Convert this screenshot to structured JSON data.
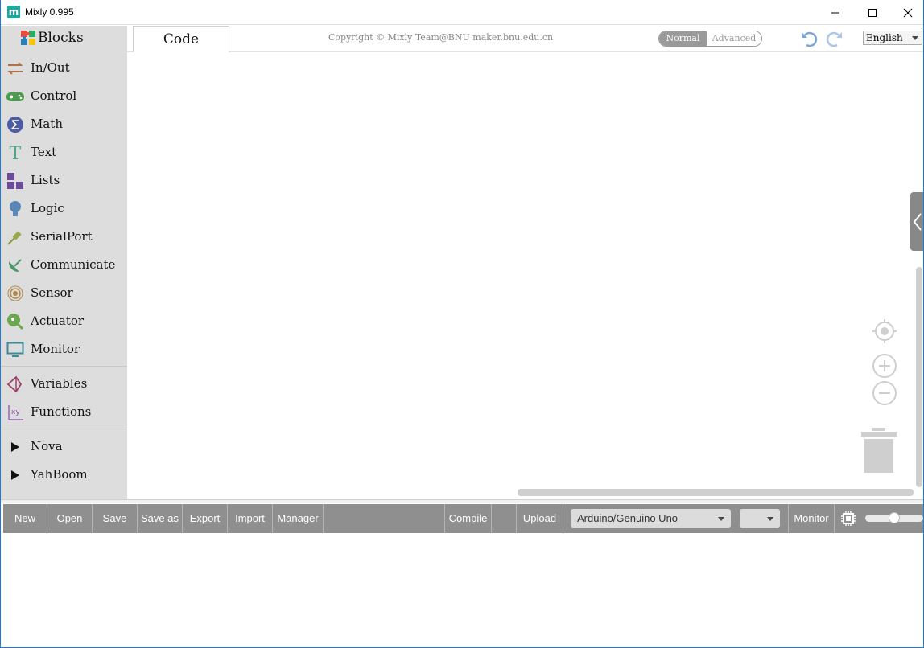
{
  "window": {
    "title": "Mixly 0.995",
    "logo_letter": "m"
  },
  "sidebar": {
    "blocks_label": "Blocks",
    "categories": [
      {
        "label": "In/Out",
        "icon": "swap-arrows-icon"
      },
      {
        "label": "Control",
        "icon": "gamepad-icon"
      },
      {
        "label": "Math",
        "icon": "sigma-icon"
      },
      {
        "label": "Text",
        "icon": "text-t-icon"
      },
      {
        "label": "Lists",
        "icon": "blocks-icon"
      },
      {
        "label": "Logic",
        "icon": "lightbulb-icon"
      },
      {
        "label": "SerialPort",
        "icon": "usb-plug-icon"
      },
      {
        "label": "Communicate",
        "icon": "satellite-dish-icon"
      },
      {
        "label": "Sensor",
        "icon": "sensor-icon"
      },
      {
        "label": "Actuator",
        "icon": "motor-icon"
      },
      {
        "label": "Monitor",
        "icon": "monitor-icon"
      }
    ],
    "variables_label": "Variables",
    "functions_label": "Functions",
    "extensions": [
      {
        "label": "Nova"
      },
      {
        "label": "YahBoom"
      }
    ]
  },
  "header": {
    "code_tab": "Code",
    "copyright": "Copyright © Mixly Team@BNU maker.bnu.edu.cn",
    "mode_normal": "Normal",
    "mode_advanced": "Advanced",
    "language": "English"
  },
  "toolbar": {
    "new": "New",
    "open": "Open",
    "save": "Save",
    "save_as": "Save as",
    "export": "Export",
    "import": "Import",
    "manager": "Manager",
    "compile": "Compile",
    "upload": "Upload",
    "board": "Arduino/Genuino Uno",
    "monitor": "Monitor",
    "font_size_level": 0.5
  },
  "colors": {
    "toolbar_bg": "#8f8f8f",
    "sidebar_bg": "#dddddd",
    "accent": "#1fa7a0"
  }
}
